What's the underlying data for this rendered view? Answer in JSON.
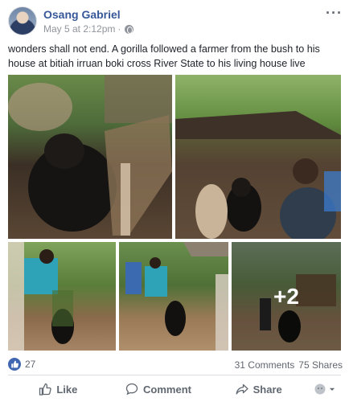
{
  "post": {
    "author": "Osang Gabriel",
    "timestamp": "May 5 at 2:12pm",
    "separator": "·",
    "more": "···",
    "text": "wonders shall not end. A gorilla followed a farmer from the bush to his house at bitiah irruan boki cross River State to his living house live",
    "extra_photos": "+2"
  },
  "stats": {
    "likes": "27",
    "comments": "31 Comments",
    "shares": "75 Shares"
  },
  "actions": {
    "like": "Like",
    "comment": "Comment",
    "share": "Share"
  },
  "icons": {
    "avatar": "profile-photo",
    "audience": "globe-icon",
    "like": "thumbs-up-icon",
    "comment": "speech-bubble-icon",
    "share": "share-arrow-icon",
    "reaction_selector": "smiley-icon"
  },
  "colors": {
    "link": "#365899",
    "accent": "#4267b2",
    "muted": "#606770"
  }
}
